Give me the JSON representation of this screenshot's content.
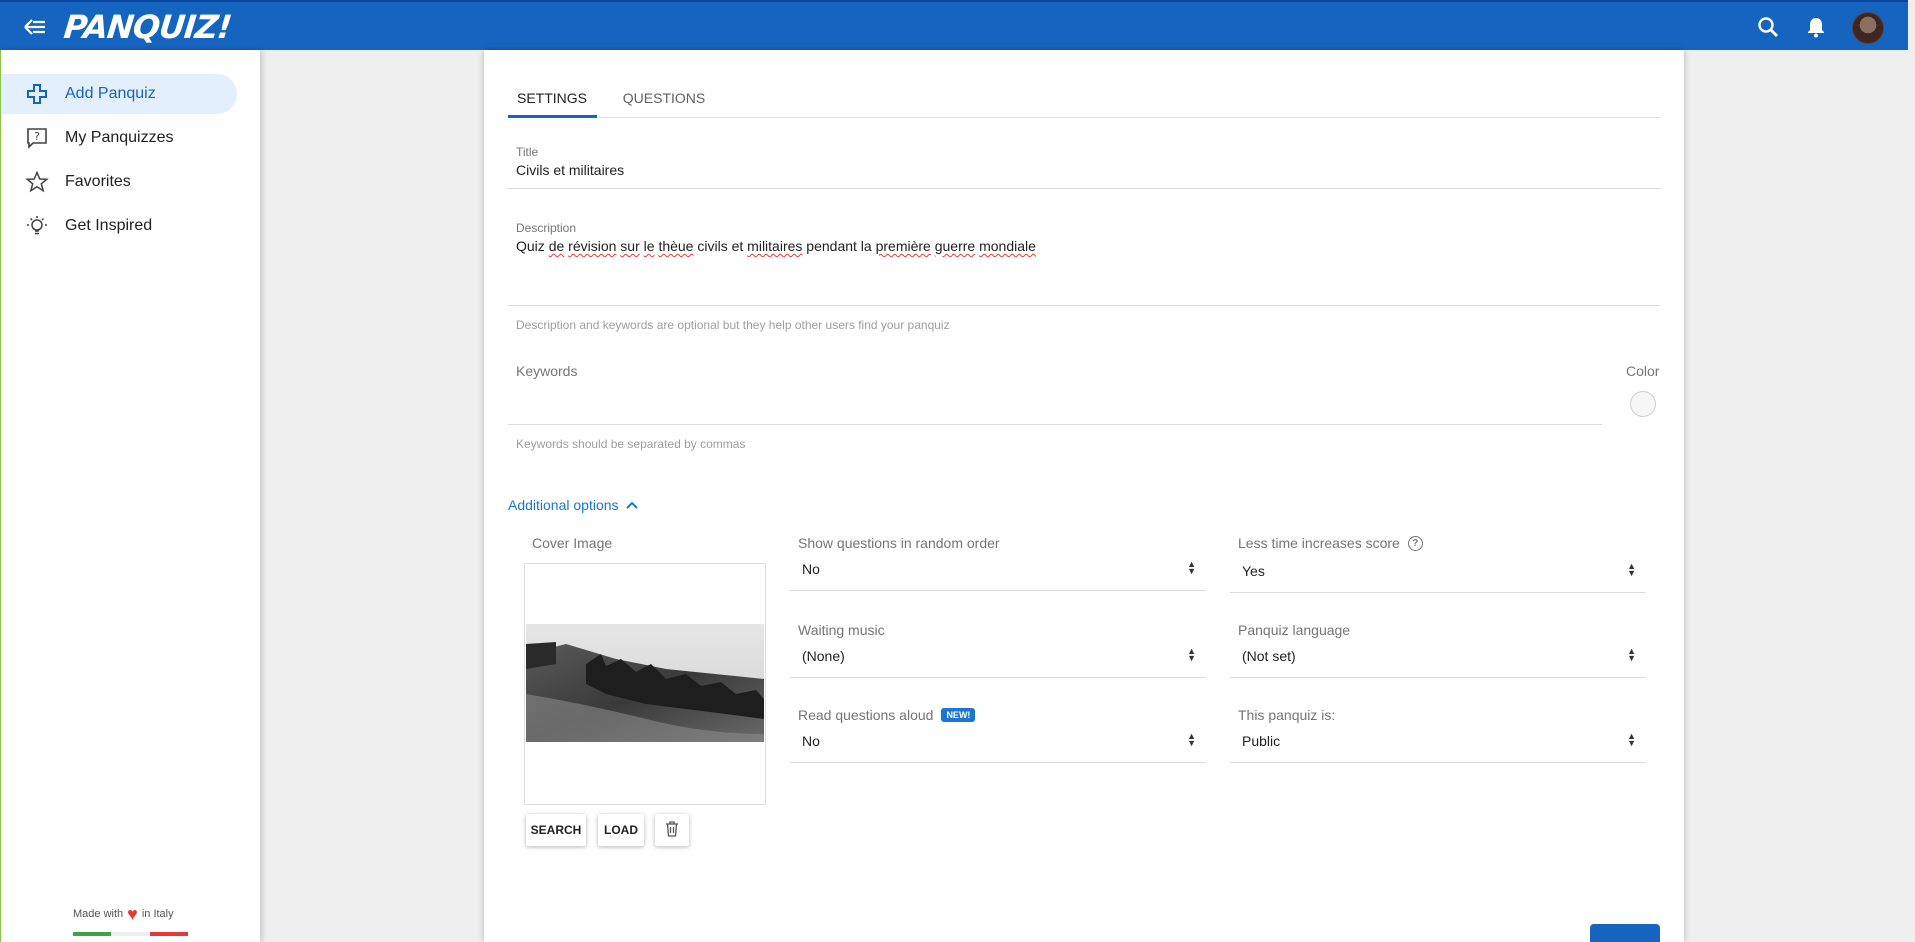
{
  "app": {
    "logo_text": "PANQUIZ!"
  },
  "topbar": {
    "back_icon": "arrow-left-icon",
    "search_icon": "search-icon",
    "bell_icon": "bell-icon",
    "avatar_icon": "avatar"
  },
  "sidebar": {
    "items": [
      {
        "label": "Add Panquiz",
        "icon": "plus-icon",
        "active": true
      },
      {
        "label": "My Panquizzes",
        "icon": "question-comment-icon",
        "active": false
      },
      {
        "label": "Favorites",
        "icon": "star-icon",
        "active": false
      },
      {
        "label": "Get Inspired",
        "icon": "lightbulb-icon",
        "active": false
      }
    ],
    "footer": {
      "made_with": "Made with",
      "in_italy": "in Italy",
      "heart": "♥"
    }
  },
  "tabs": [
    {
      "label": "SETTINGS",
      "active": true
    },
    {
      "label": "QUESTIONS",
      "active": false
    }
  ],
  "form": {
    "title": {
      "label": "Title",
      "value": "Civils et militaires"
    },
    "description": {
      "label": "Description",
      "value_parts": [
        "Quiz ",
        "de",
        " ",
        "révision",
        " ",
        "sur",
        " ",
        "le",
        " ",
        "thèue",
        " civils et ",
        "militaires",
        " pendant la ",
        "première",
        " ",
        "guerre",
        " ",
        "mondiale"
      ]
    },
    "description_hint": "Description and keywords are optional but they help other users find your panquiz",
    "keywords": {
      "label": "Keywords",
      "value": "",
      "hint": "Keywords should be separated by commas"
    },
    "color": {
      "label": "Color",
      "value": "#f7f7f7"
    },
    "additional_options": "Additional options"
  },
  "cover": {
    "label": "Cover Image",
    "buttons": {
      "search": "SEARCH",
      "load": "LOAD",
      "delete_icon": "trash-icon"
    }
  },
  "options": {
    "random_order": {
      "label": "Show questions in random order",
      "value": "No"
    },
    "waiting_music": {
      "label": "Waiting music",
      "value": "(None)"
    },
    "read_aloud": {
      "label": "Read questions aloud",
      "badge": "NEW!",
      "value": "No"
    },
    "less_time": {
      "label": "Less time increases score",
      "help": "?",
      "value": "Yes"
    },
    "language": {
      "label": "Panquiz language",
      "value": "(Not set)"
    },
    "visibility": {
      "label": "This panquiz is:",
      "value": "Public"
    }
  },
  "colors": {
    "primary": "#1565c0",
    "accent": "#1976d2",
    "active_bg": "#e3effc",
    "flag_green": "#43a047",
    "flag_white": "#eeeeee",
    "flag_red": "#e53935"
  }
}
